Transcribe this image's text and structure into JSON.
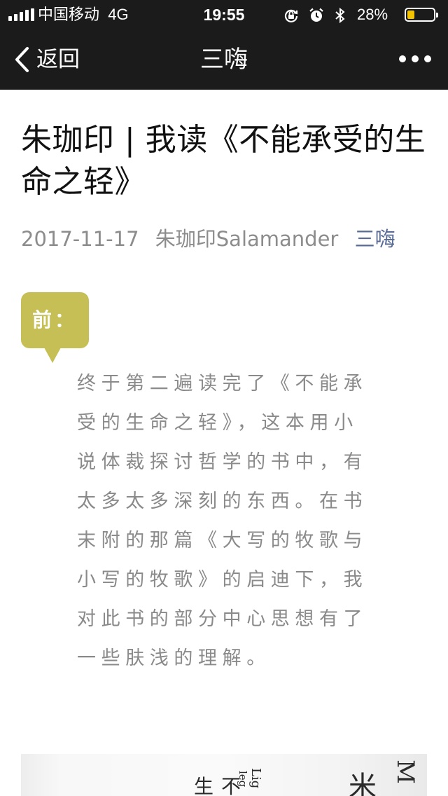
{
  "status_bar": {
    "carrier": "中国移动",
    "network": "4G",
    "time": "19:55",
    "battery_percent": "28%",
    "battery_level": 0.28,
    "battery_color": "#f5c400",
    "icons": [
      "signal-icon",
      "orientation-lock-icon",
      "alarm-icon",
      "bluetooth-icon",
      "battery-icon"
    ]
  },
  "nav": {
    "back_label": "返回",
    "title": "三嗨",
    "more_icon": "more-icon"
  },
  "article": {
    "title": "朱珈印 | 我读《不能承受的生命之轻》",
    "date": "2017-11-17",
    "author": "朱珈印Salamander",
    "account": "三嗨",
    "intro_tag": "前：",
    "intro_paragraph": "终于第二遍读完了《不能承受的生命之轻》，这本用小说体裁探讨哲学的书中，有太多太多深刻的东西。在书末附的那篇《大写的牧歌与小写的牧歌》的启迪下，我对此书的部分中心思想有了一些肤浅的理解。",
    "accent_color": "#c6bf55",
    "link_color": "#576b95"
  }
}
